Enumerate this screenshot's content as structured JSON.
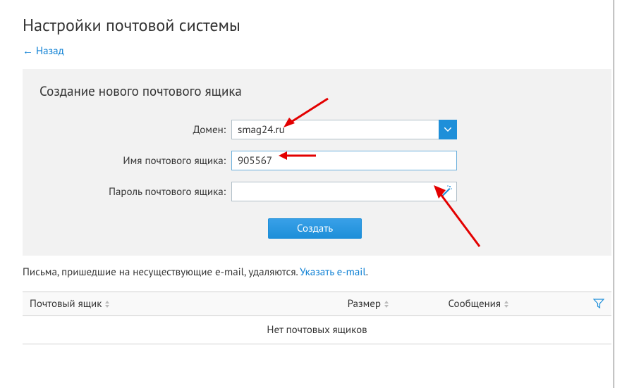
{
  "page": {
    "title": "Настройки почтовой системы",
    "back_label": "← Назад"
  },
  "form": {
    "title": "Создание нового почтового ящика",
    "domain_label": "Домен:",
    "domain_value": "smag24.ru",
    "name_label": "Имя почтового ящика:",
    "name_value": "905567",
    "pass_label": "Пароль почтового ящика:",
    "pass_value": "",
    "submit_label": "Создать"
  },
  "info": {
    "text_prefix": "Письма, пришедшие на несуществующие e-mail, удаляются. ",
    "link_label": "Указать e-mail",
    "suffix": "."
  },
  "table": {
    "col_mailbox": "Почтовый ящик",
    "col_size": "Размер",
    "col_messages": "Сообщения",
    "empty": "Нет почтовых ящиков"
  }
}
